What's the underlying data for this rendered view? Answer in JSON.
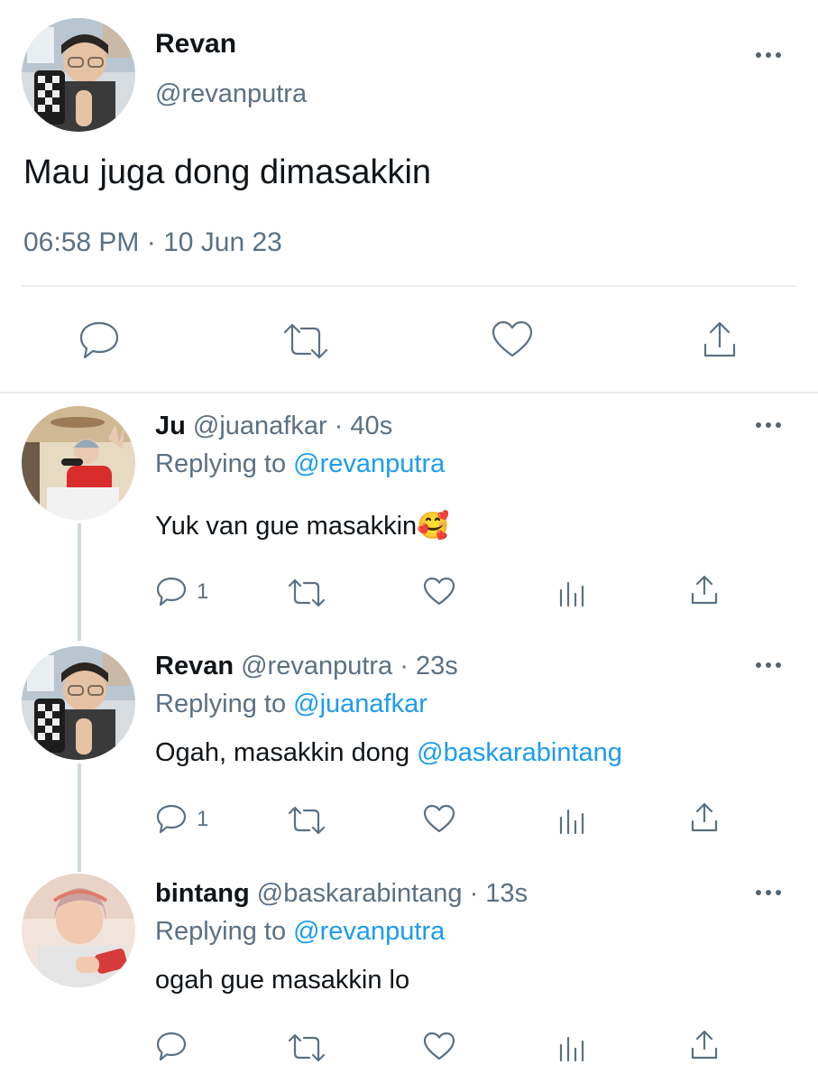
{
  "main_tweet": {
    "author_name": "Revan",
    "author_handle": "@revanputra",
    "text": "Mau juga dong dimasakkin",
    "timestamp": "06:58 PM · 10 Jun 23",
    "actions": [
      "reply-icon",
      "retweet-icon",
      "like-icon",
      "share-icon"
    ]
  },
  "replies": [
    {
      "author_name": "Ju",
      "author_handle": "@juanafkar",
      "time": "· 40s",
      "replying_label": "Replying to",
      "replying_to": "@revanputra",
      "text": "Yuk van gue masakkin🥰",
      "reply_count": "1"
    },
    {
      "author_name": "Revan",
      "author_handle": "@revanputra",
      "time": "· 23s",
      "replying_label": "Replying to",
      "replying_to": "@juanafkar",
      "text": "Ogah, masakkin dong ",
      "mention": "@baskarabintang",
      "reply_count": "1"
    },
    {
      "author_name": "bintang",
      "author_handle": "@baskarabintang",
      "time": "· 13s",
      "replying_label": "Replying to",
      "replying_to": "@revanputra",
      "text": "ogah gue masakkin lo",
      "reply_count": ""
    }
  ],
  "colors": {
    "accent": "#1d9bf0",
    "muted": "#5b7083",
    "divider": "#e8ecee",
    "thread_line": "#cfd9de"
  }
}
